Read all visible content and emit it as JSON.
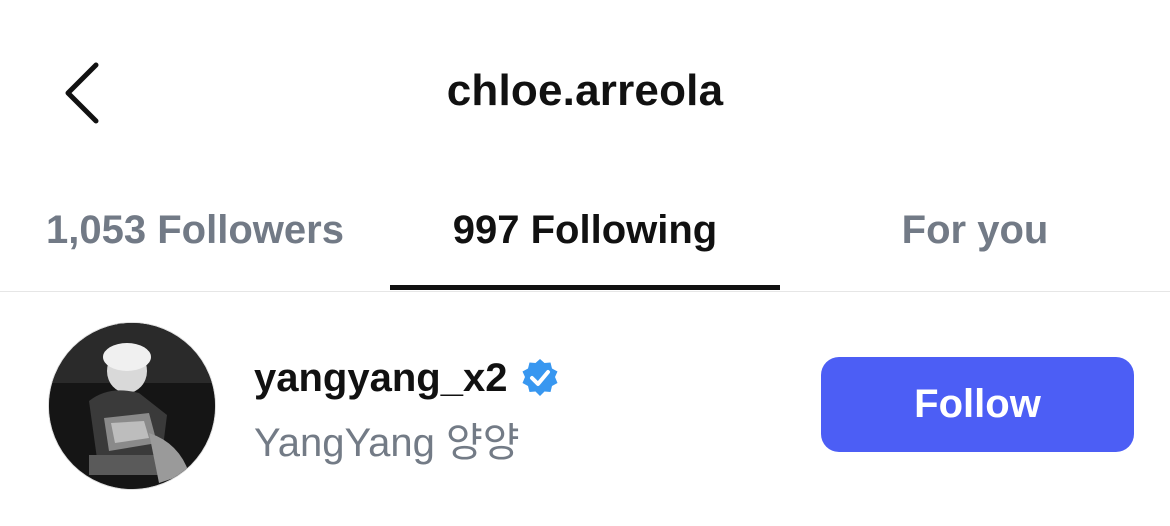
{
  "header": {
    "title": "chloe.arreola",
    "back_icon": "chevron-left-icon"
  },
  "tabs": [
    {
      "label": "1,053 Followers",
      "active": false
    },
    {
      "label": "997 Following",
      "active": true
    },
    {
      "label": "For you",
      "active": false
    }
  ],
  "list": {
    "items": [
      {
        "username": "yangyang_x2",
        "verified": true,
        "full_name": "YangYang 양양",
        "follow_label": "Follow"
      }
    ]
  },
  "colors": {
    "accent": "#4c5ef5",
    "verified": "#3897f0",
    "muted_text": "#737b86"
  }
}
